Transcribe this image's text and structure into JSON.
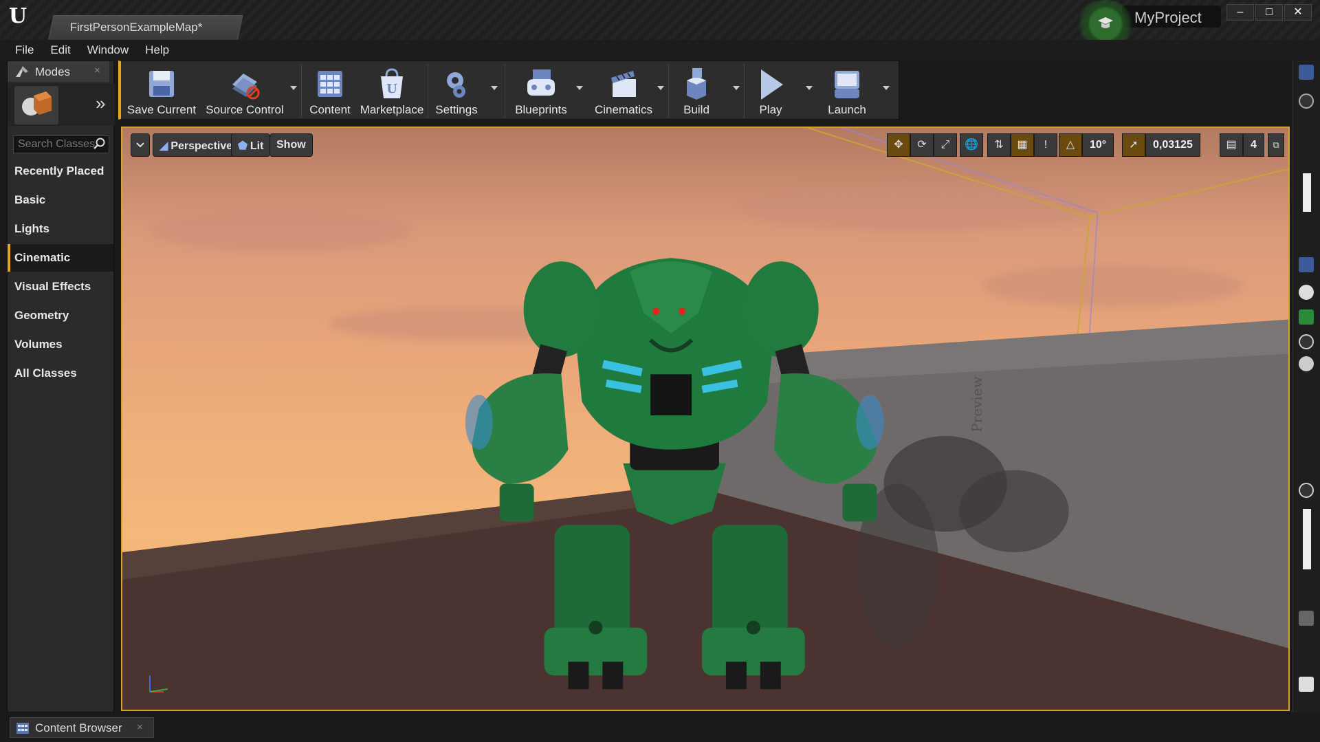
{
  "app": {
    "document_tab": "FirstPersonExampleMap*",
    "project_name": "MyProject",
    "window_controls": [
      "–",
      "□",
      "✕"
    ]
  },
  "menu": [
    "File",
    "Edit",
    "Window",
    "Help"
  ],
  "modes_panel": {
    "tab_label": "Modes",
    "close": "×",
    "expand": "»",
    "search_placeholder": "Search Classes",
    "categories": [
      "Recently Placed",
      "Basic",
      "Lights",
      "Cinematic",
      "Visual Effects",
      "Geometry",
      "Volumes",
      "All Classes"
    ],
    "active_category": "Cinematic"
  },
  "toolbar": {
    "items": [
      {
        "label": "Save Current",
        "icon": "save-icon"
      },
      {
        "label": "Source Control",
        "icon": "source-control-icon"
      },
      {
        "label": "Content",
        "icon": "content-icon"
      },
      {
        "label": "Marketplace",
        "icon": "marketplace-icon"
      },
      {
        "label": "Settings",
        "icon": "settings-icon"
      },
      {
        "label": "Blueprints",
        "icon": "blueprints-icon"
      },
      {
        "label": "Cinematics",
        "icon": "cinematics-icon"
      },
      {
        "label": "Build",
        "icon": "build-icon"
      },
      {
        "label": "Play",
        "icon": "play-icon"
      },
      {
        "label": "Launch",
        "icon": "launch-icon"
      }
    ]
  },
  "viewport": {
    "view_mode": "Perspective",
    "lighting_mode": "Lit",
    "show_label": "Show",
    "rotation_snap": "10°",
    "scale_snap": "0,03125",
    "camera_speed": "4",
    "watermark": "Preview",
    "accent_color": "#d4a52a"
  },
  "bottom": {
    "content_browser_tab": "Content Browser",
    "close": "×"
  }
}
